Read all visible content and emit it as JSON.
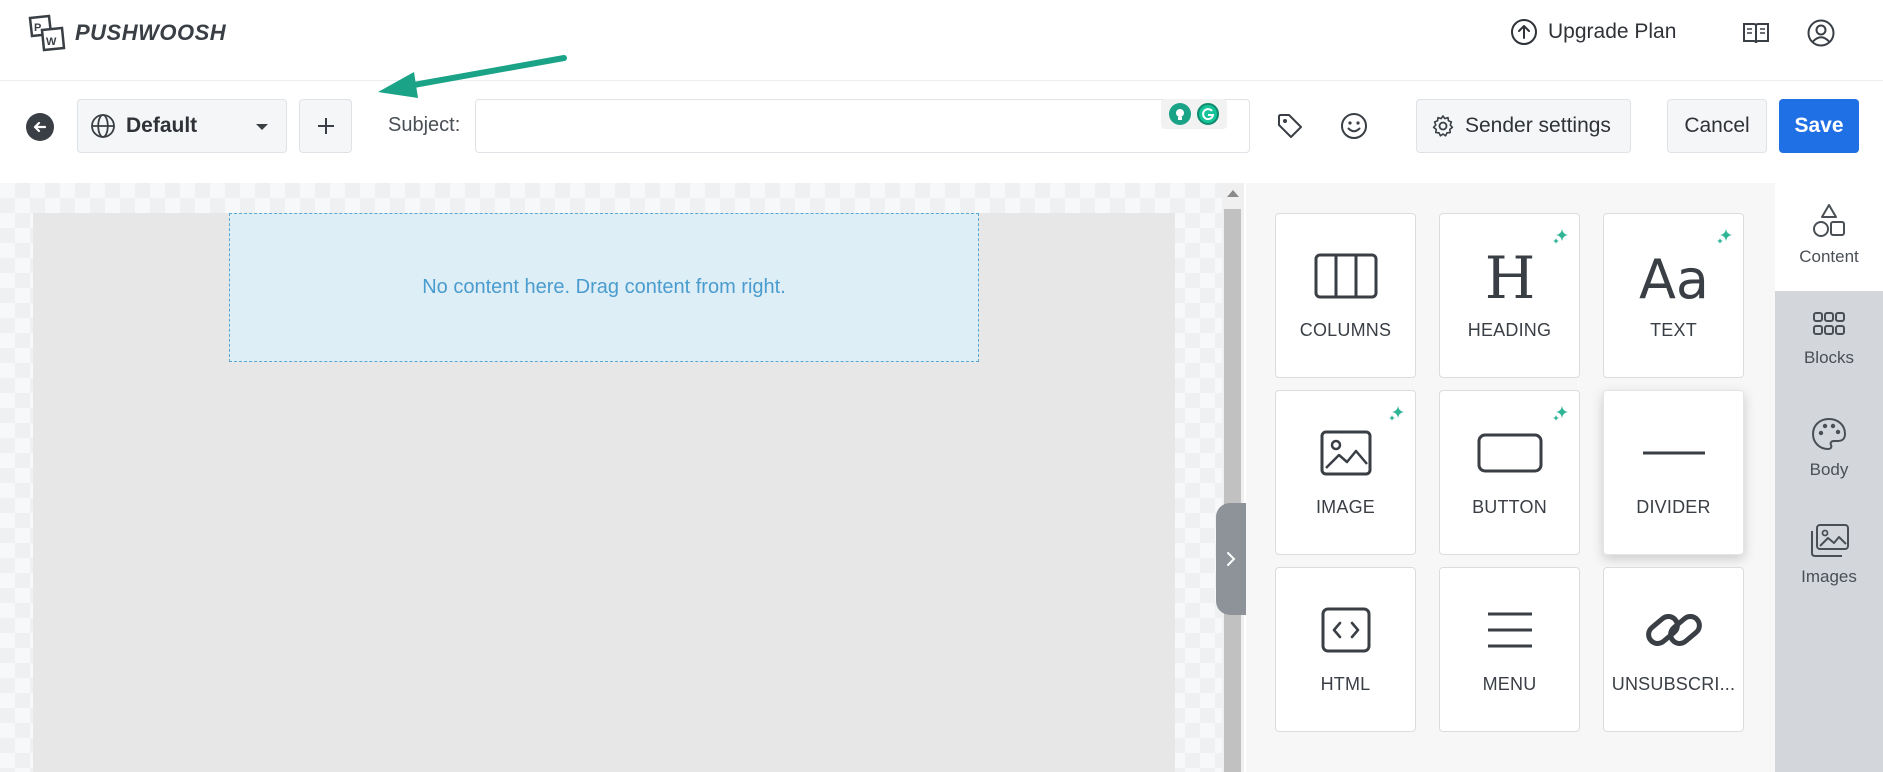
{
  "app": {
    "brand": "PUSHWOOSH"
  },
  "header": {
    "upgrade_label": "Upgrade Plan"
  },
  "toolbar": {
    "language": "Default",
    "subject_label": "Subject:",
    "subject_value": "",
    "sender_settings_label": "Sender settings",
    "cancel_label": "Cancel",
    "save_label": "Save"
  },
  "canvas": {
    "empty_message": "No content here. Drag content from right."
  },
  "content_tiles": [
    {
      "label": "COLUMNS",
      "icon": "columns-icon",
      "ai": false
    },
    {
      "label": "HEADING",
      "icon": "heading-icon",
      "ai": true
    },
    {
      "label": "TEXT",
      "icon": "text-icon",
      "ai": true
    },
    {
      "label": "IMAGE",
      "icon": "image-icon",
      "ai": true
    },
    {
      "label": "BUTTON",
      "icon": "button-icon",
      "ai": true
    },
    {
      "label": "DIVIDER",
      "icon": "divider-icon",
      "ai": false
    },
    {
      "label": "HTML",
      "icon": "html-icon",
      "ai": false
    },
    {
      "label": "MENU",
      "icon": "menu-icon",
      "ai": false
    },
    {
      "label": "UNSUBSCRI...",
      "icon": "link-icon",
      "ai": false
    }
  ],
  "side_nav": [
    {
      "label": "Content",
      "icon": "shapes-icon",
      "active": true
    },
    {
      "label": "Blocks",
      "icon": "grid-icon",
      "active": false
    },
    {
      "label": "Body",
      "icon": "palette-icon",
      "active": false
    },
    {
      "label": "Images",
      "icon": "images-icon",
      "active": false
    }
  ],
  "colors": {
    "primary": "#1f6fe5",
    "ai_sparkle": "#2fb596",
    "arrow": "#1aa387",
    "drop_text": "#4a9ccf"
  }
}
